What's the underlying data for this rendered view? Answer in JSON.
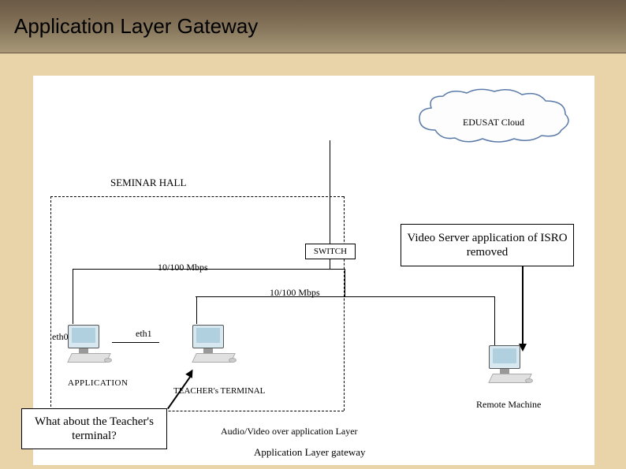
{
  "title": "Application Layer Gateway",
  "cloud_label": "EDUSAT Cloud",
  "seminar_hall": "SEMINAR HALL",
  "switch_label": "SWITCH",
  "speed1": "10/100 Mbps",
  "speed2": "10/100 Mbps",
  "eth0": "eth0",
  "eth1": "eth1",
  "app_gateway_label": "APPLICATION",
  "teacher_terminal": "TEACHER's TERMINAL",
  "remote_machine": "Remote Machine",
  "callout_video": "Video Server application of ISRO removed",
  "callout_teacher": "What about the Teacher's terminal?",
  "audio_video": "Audio/Video over application Layer",
  "caption": "Application Layer gateway"
}
